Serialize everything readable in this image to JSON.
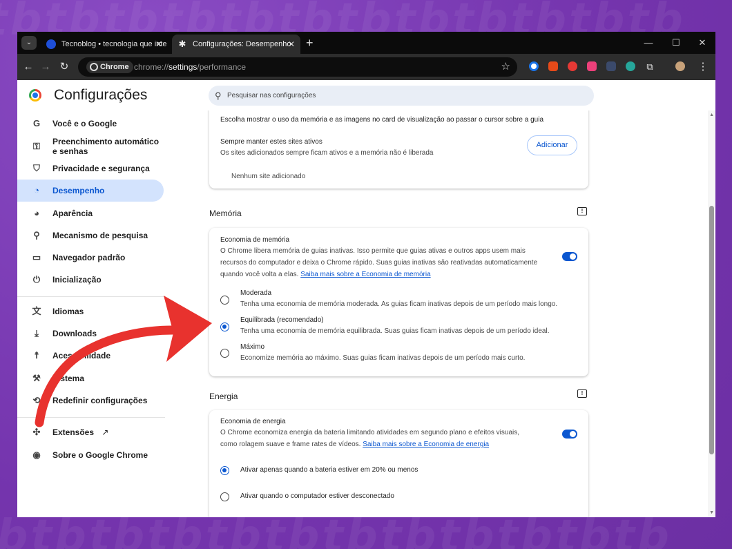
{
  "browser": {
    "tabs": [
      {
        "label": "Tecnoblog • tecnologia que inte"
      },
      {
        "label": "Configurações: Desempenho"
      }
    ],
    "omnibox": {
      "chip": "Chrome",
      "url_prefix": "chrome://",
      "url_bold": "settings",
      "url_suffix": "/performance"
    }
  },
  "settings": {
    "title": "Configurações",
    "search_placeholder": "Pesquisar nas configurações",
    "sidebar": [
      {
        "label": "Você e o Google",
        "icon": "google-g-icon"
      },
      {
        "label": "Preenchimento automático e senhas",
        "icon": "key-icon"
      },
      {
        "label": "Privacidade e segurança",
        "icon": "shield-icon"
      },
      {
        "label": "Desempenho",
        "icon": "speedometer-icon",
        "active": true
      },
      {
        "label": "Aparência",
        "icon": "palette-icon"
      },
      {
        "label": "Mecanismo de pesquisa",
        "icon": "search-icon"
      },
      {
        "label": "Navegador padrão",
        "icon": "browser-window-icon"
      },
      {
        "label": "Inicialização",
        "icon": "power-icon"
      },
      {
        "label": "Idiomas",
        "icon": "translate-icon"
      },
      {
        "label": "Downloads",
        "icon": "download-icon"
      },
      {
        "label": "Acessibilidade",
        "icon": "accessibility-icon"
      },
      {
        "label": "Sistema",
        "icon": "wrench-icon"
      },
      {
        "label": "Redefinir configurações",
        "icon": "reset-icon"
      },
      {
        "label": "Extensões",
        "icon": "puzzle-icon"
      },
      {
        "label": "Sobre o Google Chrome",
        "icon": "chrome-icon"
      }
    ],
    "top_card": {
      "hover_text": "Escolha mostrar o uso da memória e as imagens no card de visualização ao passar o cursor sobre a guia",
      "always_active_title": "Sempre manter estes sites ativos",
      "always_active_desc": "Os sites adicionados sempre ficam ativos e a memória não é liberada",
      "add_button": "Adicionar",
      "empty": "Nenhum site adicionado"
    },
    "memory": {
      "section": "Memória",
      "title": "Economia de memória",
      "desc_line1": "O Chrome libera memória de guias inativas. Isso permite que guias ativas e outros apps usem mais",
      "desc_line2": "recursos do computador e deixa o Chrome rápido. Suas guias inativas são reativadas automaticamente",
      "desc_line3": "quando você volta a elas.",
      "link": "Saiba mais sobre a Economia de memória",
      "enabled": true,
      "options": [
        {
          "label": "Moderada",
          "desc": "Tenha uma economia de memória moderada. As guias ficam inativas depois de um período mais longo.",
          "selected": false
        },
        {
          "label": "Equilibrada (recomendado)",
          "desc": "Tenha uma economia de memória equilibrada. Suas guias ficam inativas depois de um período ideal.",
          "selected": true
        },
        {
          "label": "Máximo",
          "desc": "Economize memória ao máximo. Suas guias ficam inativas depois de um período mais curto.",
          "selected": false
        }
      ]
    },
    "energy": {
      "section": "Energia",
      "title": "Economia de energia",
      "desc_line1": "O Chrome economiza energia da bateria limitando atividades em segundo plano e efeitos visuais,",
      "desc_line2": "como rolagem suave e frame rates de vídeos.",
      "link": "Saiba mais sobre a Economia de energia",
      "enabled": true,
      "options": [
        {
          "label": "Ativar apenas quando a bateria estiver em 20% ou menos",
          "selected": true
        },
        {
          "label": "Ativar quando o computador estiver desconectado",
          "selected": false
        }
      ]
    }
  },
  "colors": {
    "accent": "#0b57d0",
    "background": "#7a3fb2",
    "arrow": "#e8322e"
  }
}
